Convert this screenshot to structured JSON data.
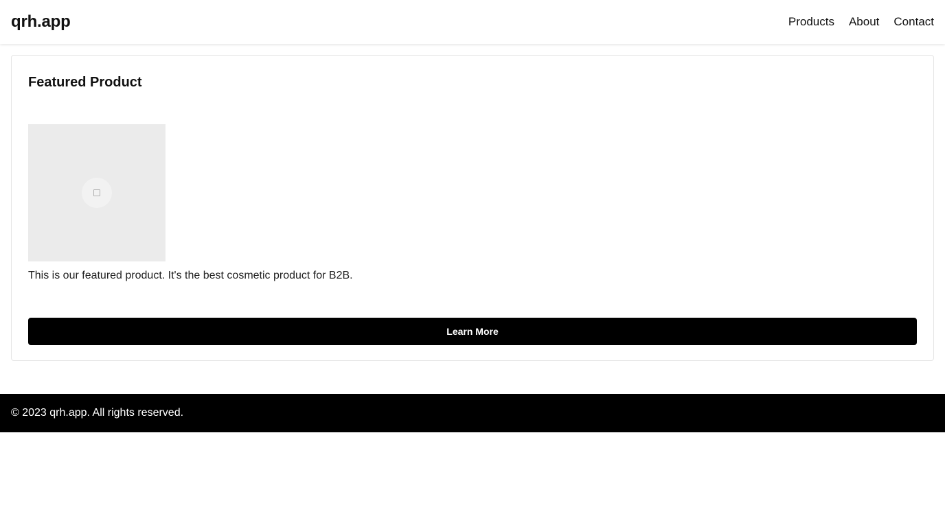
{
  "header": {
    "logo": "qrh.app",
    "nav": [
      {
        "label": "Products"
      },
      {
        "label": "About"
      },
      {
        "label": "Contact"
      }
    ]
  },
  "main": {
    "card": {
      "title": "Featured Product",
      "image_icon": "image-placeholder-icon",
      "description": "This is our featured product. It's the best cosmetic product for B2B.",
      "button_label": "Learn More"
    }
  },
  "footer": {
    "text": "© 2023 qrh.app. All rights reserved."
  },
  "colors": {
    "primary": "#000000",
    "background": "#ffffff",
    "image_placeholder": "#ebebeb"
  }
}
